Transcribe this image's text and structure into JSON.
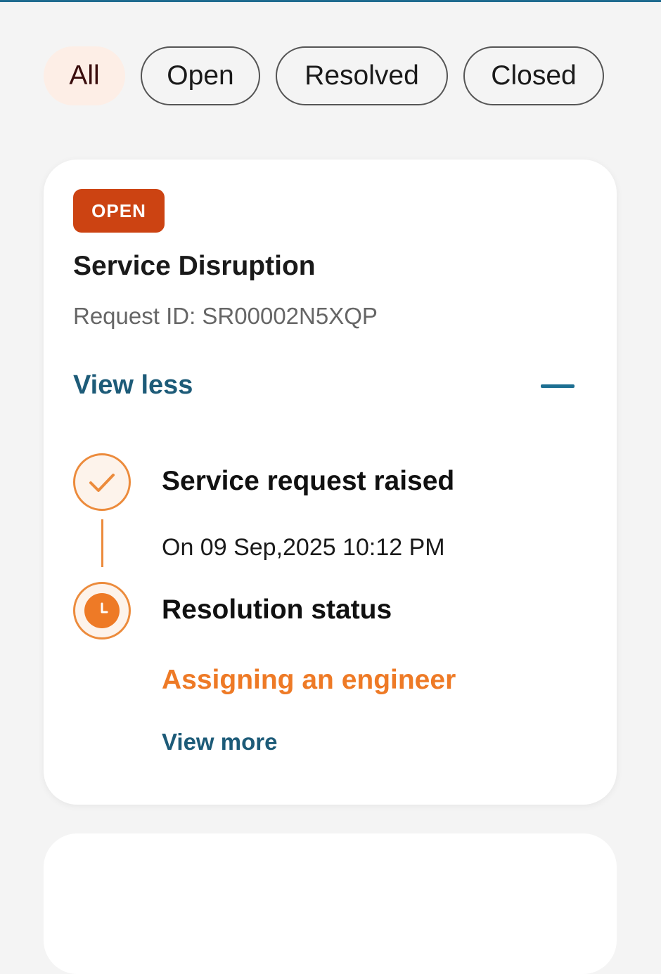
{
  "filters": {
    "items": [
      {
        "label": "All",
        "active": true
      },
      {
        "label": "Open",
        "active": false
      },
      {
        "label": "Resolved",
        "active": false
      },
      {
        "label": "Closed",
        "active": false
      }
    ]
  },
  "request_card": {
    "status_badge": "OPEN",
    "title": "Service Disruption",
    "request_id": "Request ID: SR00002N5XQP",
    "toggle_label": "View less",
    "toggle_icon": "minus-icon",
    "timeline": [
      {
        "icon": "check-icon",
        "title": "Service request raised",
        "detail": "On 09 Sep,2025 10:12 PM"
      },
      {
        "icon": "clock-icon",
        "title": "Resolution status",
        "detail": "Assigning an engineer"
      }
    ],
    "view_more_label": "View more"
  },
  "colors": {
    "accent_blue": "#1d5b78",
    "status_orange": "#ee7a26",
    "badge_red": "#cc4312",
    "chip_active_bg": "#fdeee6"
  }
}
